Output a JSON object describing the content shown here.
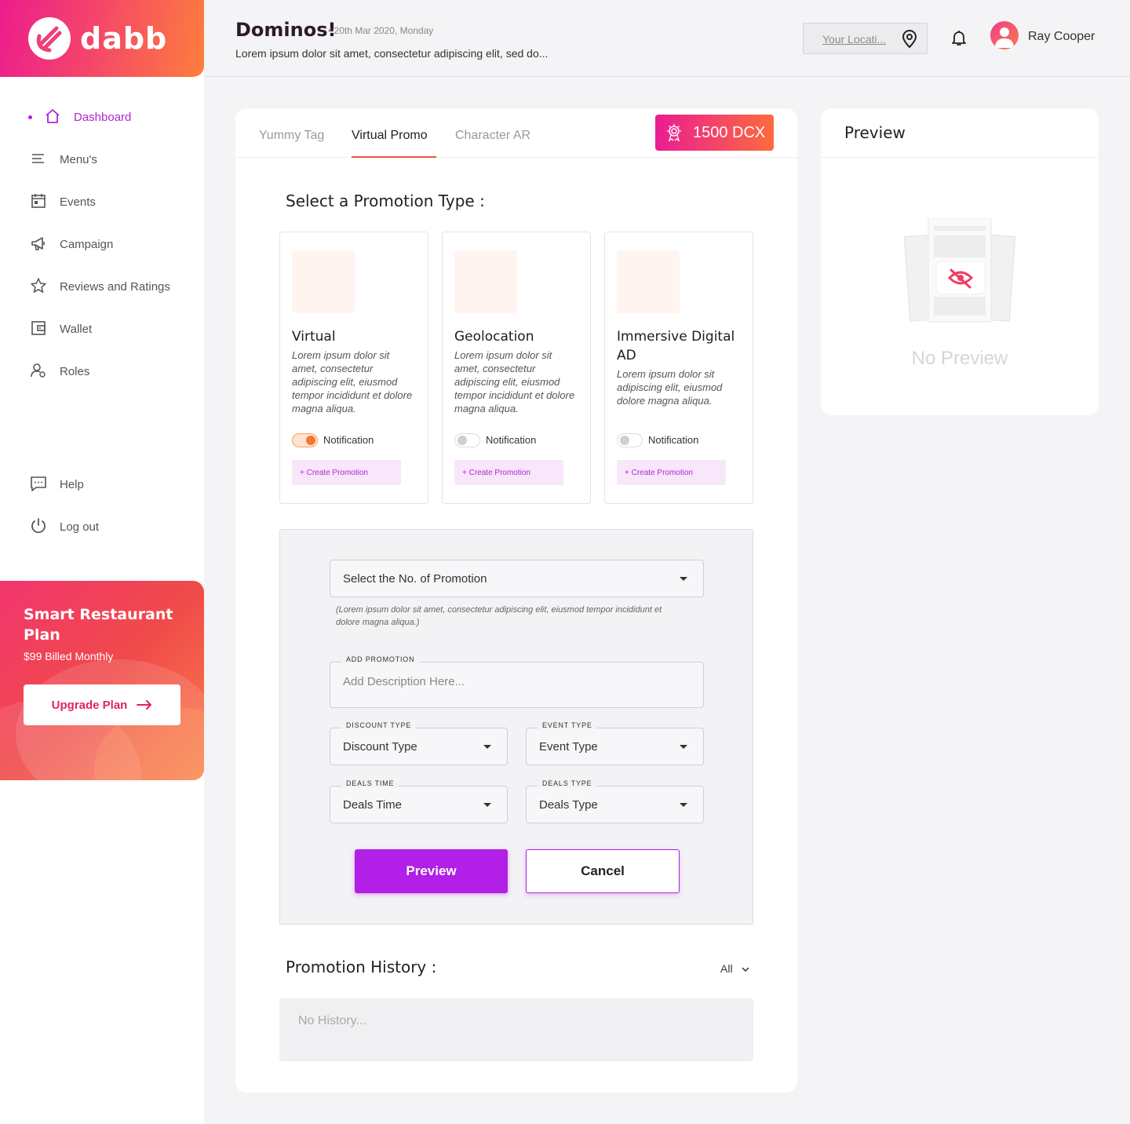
{
  "brand": {
    "name": "dabb"
  },
  "sidebar": {
    "items": [
      {
        "label": "Dashboard",
        "icon": "home-icon",
        "active": true
      },
      {
        "label": "Menu's",
        "icon": "menu-icon"
      },
      {
        "label": "Events",
        "icon": "calendar-icon"
      },
      {
        "label": "Campaign",
        "icon": "megaphone-icon"
      },
      {
        "label": "Reviews and Ratings",
        "icon": "star-icon"
      },
      {
        "label": "Wallet",
        "icon": "wallet-icon"
      },
      {
        "label": "Roles",
        "icon": "roles-icon"
      }
    ],
    "bottom_items": [
      {
        "label": "Help",
        "icon": "chat-icon"
      },
      {
        "label": "Log out",
        "icon": "power-icon"
      }
    ],
    "plan": {
      "title": "Smart Restaurant Plan",
      "price": "$99 Billed Monthly",
      "button": "Upgrade Plan"
    }
  },
  "header": {
    "title": "Dominos!",
    "date": "• 20th Mar 2020, Monday",
    "subtitle": "Lorem ipsum dolor sit amet, consectetur adipiscing elit, sed do...",
    "location_placeholder": "Your Locati...",
    "user_name": "Ray Cooper"
  },
  "main": {
    "tabs": [
      {
        "label": "Yummy Tag"
      },
      {
        "label": "Virtual Promo",
        "active": true
      },
      {
        "label": "Character AR"
      }
    ],
    "dcx_balance": "1500 DCX",
    "section_title": "Select a Promotion Type :",
    "promo_types": [
      {
        "name": "Virtual",
        "desc": "Lorem ipsum dolor sit amet, consectetur adipiscing elit, eiusmod tempor incididunt et dolore magna aliqua.",
        "notification_label": "Notification",
        "notification_on": true,
        "cta": "+ Create Promotion"
      },
      {
        "name": "Geolocation",
        "desc": "Lorem ipsum dolor sit amet, consectetur adipiscing elit, eiusmod tempor incididunt et dolore magna aliqua.",
        "notification_label": "Notification",
        "notification_on": false,
        "cta": "+ Create Promotion"
      },
      {
        "name": "Immersive Digital AD",
        "desc": "Lorem ipsum dolor sit adipiscing elit, eiusmod dolore magna aliqua.",
        "notification_label": "Notification",
        "notification_on": false,
        "cta": "+ Create Promotion"
      }
    ],
    "form": {
      "promotion_count_select": "Select the No. of Promotion",
      "hint": "(Lorem ipsum dolor sit amet, consectetur adipiscing elit, eiusmod tempor incididunt et dolore magna aliqua.)",
      "add_promotion_label": "ADD PROMOTION",
      "add_promotion_placeholder": "Add Description Here...",
      "discount_type_label": "DISCOUNT TYPE",
      "discount_type_value": "Discount Type",
      "event_type_label": "EVENT TYPE",
      "event_type_value": "Event Type",
      "deals_time_label": "DEALS TIME",
      "deals_time_value": "Deals Time",
      "deals_type_label": "DEALS TYPE",
      "deals_type_value": "Deals Type",
      "preview_button": "Preview",
      "cancel_button": "Cancel"
    },
    "history": {
      "title": "Promotion History :",
      "filter": "All",
      "empty_text": "No History..."
    }
  },
  "preview_panel": {
    "title": "Preview",
    "empty_text": "No Preview"
  },
  "colors": {
    "accent_purple": "#b21fe6",
    "brand_gradient_start": "#ec1d8c",
    "brand_gradient_end": "#fd7e3c",
    "toggle_on": "#f5762c"
  }
}
